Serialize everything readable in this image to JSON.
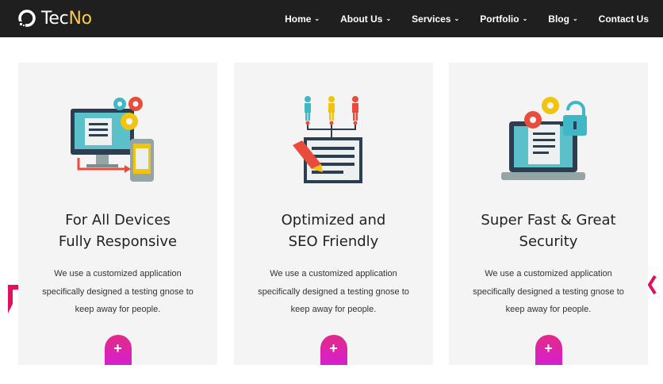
{
  "brand": {
    "name_main": "Tec",
    "name_accent": "No"
  },
  "nav": {
    "items": [
      {
        "label": "Home",
        "chevron": "⌄"
      },
      {
        "label": "About Us",
        "chevron": "⌄"
      },
      {
        "label": "Services",
        "chevron": "⌄"
      },
      {
        "label": "Portfolio",
        "chevron": "⌄"
      },
      {
        "label": "Blog",
        "chevron": "⌄"
      },
      {
        "label": "Contact Us",
        "chevron": ""
      }
    ]
  },
  "cards": [
    {
      "title_line1": "For All Devices",
      "title_line2": "Fully Responsive",
      "text": "We use a customized application specifically designed a testing gnose to keep away for people.",
      "button": "+",
      "icon": "devices-icon"
    },
    {
      "title_line1": "Optimized and",
      "title_line2": "SEO Friendly",
      "text": "We use a customized application specifically designed a testing gnose to keep away for people.",
      "button": "+",
      "icon": "seo-icon"
    },
    {
      "title_line1": "Super Fast & Great",
      "title_line2": "Security",
      "text": "We use a customized application specifically designed a testing gnose to keep away for people.",
      "button": "+",
      "icon": "security-icon"
    }
  ],
  "colors": {
    "navbar": "#1f1f1f",
    "brand_accent": "#f6c84c",
    "card_bg": "#f4f4f4",
    "button_gradient_start": "#e32a86",
    "button_gradient_end": "#d61fd0",
    "slider_arrow": "#e0115f"
  }
}
